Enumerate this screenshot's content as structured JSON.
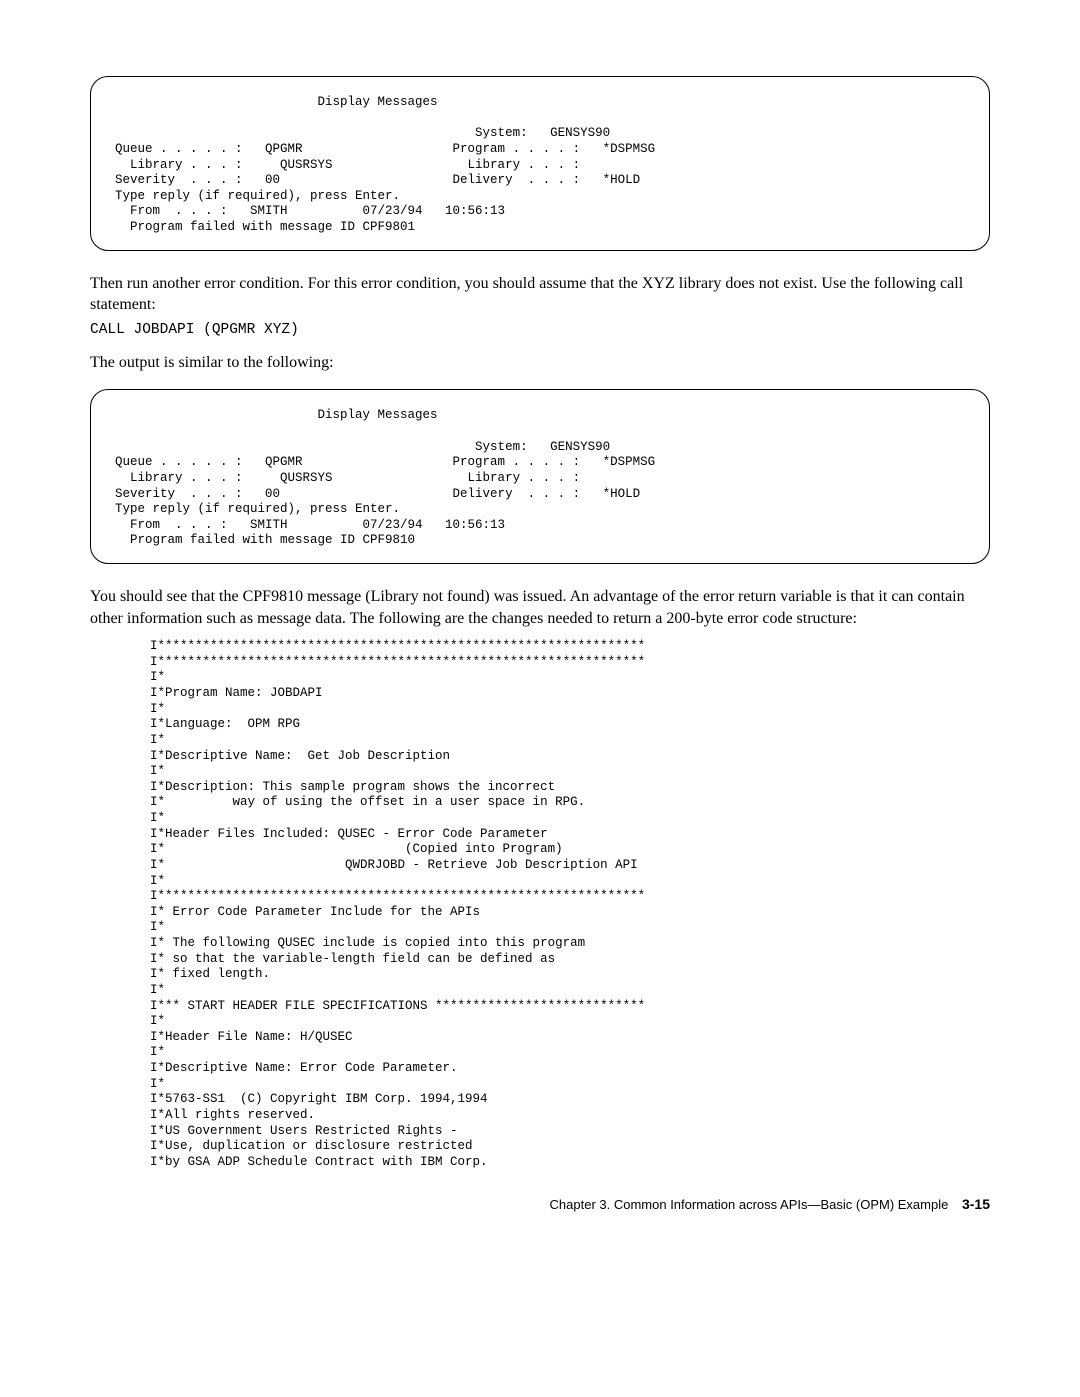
{
  "screen1": "                           Display Messages\n\n                                                System:   GENSYS90\nQueue . . . . . :   QPGMR                    Program . . . . :   *DSPMSG\n  Library . . . :     QUSRSYS                  Library . . . :\nSeverity  . . . :   00                       Delivery  . . . :   *HOLD\nType reply (if required), press Enter.\n  From  . . . :   SMITH          07/23/94   10:56:13\n  Program failed with message ID CPF9801",
  "para1": "Then run another error condition.  For this error condition, you should assume that the XYZ library does not exist.  Use the following call statement:",
  "call1": "CALL JOBDAPI (QPGMR XYZ)",
  "para2": "The output is similar to the following:",
  "screen2": "                           Display Messages\n\n                                                System:   GENSYS90\nQueue . . . . . :   QPGMR                    Program . . . . :   *DSPMSG\n  Library . . . :     QUSRSYS                  Library . . . :\nSeverity  . . . :   00                       Delivery  . . . :   *HOLD\nType reply (if required), press Enter.\n  From  . . . :   SMITH          07/23/94   10:56:13\n  Program failed with message ID CPF9810",
  "para3": "You should see that the CPF9810 message (Library not found) was issued.  An advantage of the error return variable is that it can contain other information such as message data.  The following are the changes needed to return a 200-byte error code structure:",
  "code": "I*****************************************************************\nI*****************************************************************\nI*\nI*Program Name: JOBDAPI\nI*\nI*Language:  OPM RPG\nI*\nI*Descriptive Name:  Get Job Description\nI*\nI*Description: This sample program shows the incorrect\nI*         way of using the offset in a user space in RPG.\nI*\nI*Header Files Included: QUSEC - Error Code Parameter\nI*                                (Copied into Program)\nI*                        QWDRJOBD - Retrieve Job Description API\nI*\nI*****************************************************************\nI* Error Code Parameter Include for the APIs\nI*\nI* The following QUSEC include is copied into this program\nI* so that the variable-length field can be defined as\nI* fixed length.\nI*\nI*** START HEADER FILE SPECIFICATIONS ****************************\nI*\nI*Header File Name: H/QUSEC\nI*\nI*Descriptive Name: Error Code Parameter.\nI*\nI*5763-SS1  (C) Copyright IBM Corp. 1994,1994\nI*All rights reserved.\nI*US Government Users Restricted Rights -\nI*Use, duplication or disclosure restricted\nI*by GSA ADP Schedule Contract with IBM Corp.",
  "footer": {
    "chapter": "Chapter 3.  Common Information across APIs—Basic (OPM) Example",
    "page": "3-15"
  }
}
